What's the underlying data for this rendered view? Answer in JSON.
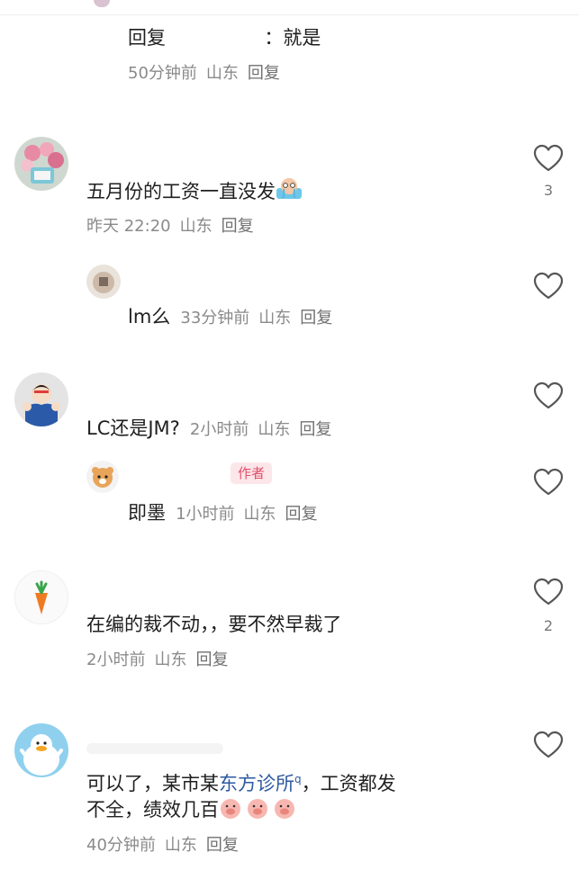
{
  "comments": [
    {
      "reply_text": "回复",
      "colon_text": "：就是",
      "time": "50分钟前",
      "location": "山东",
      "reply_label": "回复"
    },
    {
      "text": "五月份的工资一直没发",
      "time": "昨天 22:20",
      "location": "山东",
      "reply_label": "回复",
      "likes": "3",
      "reply": {
        "text": "lm么",
        "time": "33分钟前",
        "location": "山东",
        "reply_label": "回复"
      }
    },
    {
      "text": "LC还是JM?",
      "time": "2小时前",
      "location": "山东",
      "reply_label": "回复",
      "reply": {
        "badge": "作者",
        "text": "即墨",
        "time": "1小时前",
        "location": "山东",
        "reply_label": "回复"
      }
    },
    {
      "text": "在编的裁不动，，要不然早裁了",
      "time": "2小时前",
      "location": "山东",
      "reply_label": "回复",
      "likes": "2"
    },
    {
      "text_part1": "可以了，某市某",
      "link": "东方诊所",
      "link_icon": "q",
      "text_part2": "，工资都发",
      "text_line2": "不全，绩效几百",
      "time": "40分钟前",
      "location": "山东",
      "reply_label": "回复"
    }
  ],
  "icons": {
    "like": "heart-outline-icon",
    "colors": {
      "link": "#2c5aa0",
      "badge_bg": "#fde6ea",
      "badge_text": "#e2506b",
      "meta": "#8a8a8a"
    }
  }
}
